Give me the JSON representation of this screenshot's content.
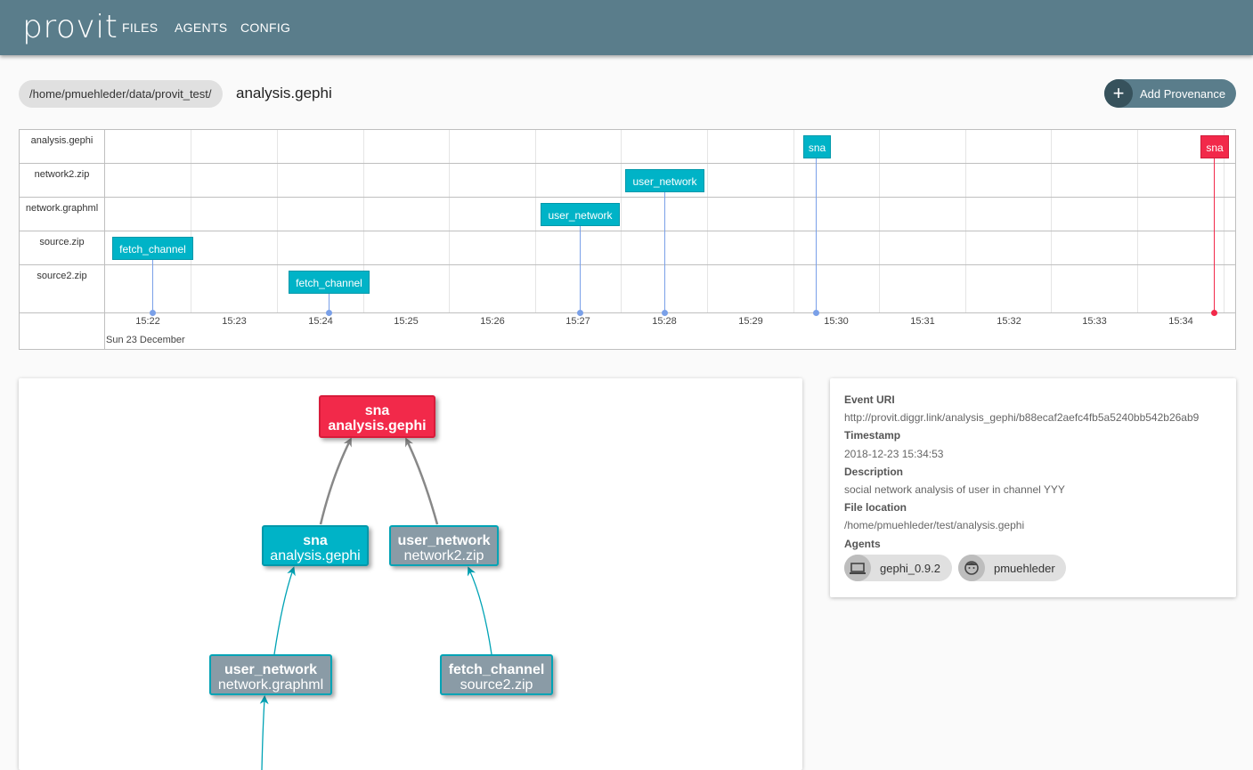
{
  "app": {
    "brand": "provit"
  },
  "nav": {
    "files": "FILES",
    "agents": "AGENTS",
    "config": "CONFIG"
  },
  "breadcrumb": {
    "path": "/home/pmuehleder/data/provit_test/",
    "file": "analysis.gephi"
  },
  "actions": {
    "add_provenance": "Add Provenance",
    "add_icon": "+"
  },
  "timeline": {
    "rows": [
      "analysis.gephi",
      "network2.zip",
      "network.graphml",
      "source.zip",
      "source2.zip"
    ],
    "ticks": [
      "15:22",
      "15:23",
      "15:24",
      "15:25",
      "15:26",
      "15:27",
      "15:28",
      "15:29",
      "15:30",
      "15:31",
      "15:32",
      "15:33",
      "15:34"
    ],
    "date": "Sun 23 December",
    "events": [
      {
        "label": "sna",
        "row": "analysis.gephi",
        "time": "15:29:45",
        "color": "#00b3c7"
      },
      {
        "label": "sna",
        "row": "analysis.gephi",
        "time": "15:34:53",
        "color": "#f2294a",
        "selected": true
      },
      {
        "label": "user_network",
        "row": "network2.zip",
        "time": "15:28:00",
        "color": "#00b3c7"
      },
      {
        "label": "user_network",
        "row": "network.graphml",
        "time": "15:27:00",
        "color": "#00b3c7"
      },
      {
        "label": "fetch_channel",
        "row": "source.zip",
        "time": "15:22:00",
        "color": "#00b3c7"
      },
      {
        "label": "fetch_channel",
        "row": "source2.zip",
        "time": "15:24:00",
        "color": "#00b3c7"
      }
    ]
  },
  "graph": {
    "nodes": {
      "sna_selected": {
        "activity": "sna",
        "file": "analysis.gephi",
        "color": "#f2294a"
      },
      "sna": {
        "activity": "sna",
        "file": "analysis.gephi",
        "color": "#00b3c7"
      },
      "user_network_2": {
        "activity": "user_network",
        "file": "network2.zip",
        "color": "#8a9ba6"
      },
      "user_network_graphml": {
        "activity": "user_network",
        "file": "network.graphml",
        "color": "#8a9ba6"
      },
      "fetch_channel_2": {
        "activity": "fetch_channel",
        "file": "source2.zip",
        "color": "#8a9ba6"
      }
    }
  },
  "details": {
    "event_uri_label": "Event URI",
    "event_uri": "http://provit.diggr.link/analysis_gephi/b88ecaf2aefc4fb5a5240bb542b26ab9",
    "timestamp_label": "Timestamp",
    "timestamp": "2018-12-23 15:34:53",
    "description_label": "Description",
    "description": "social network analysis of user in channel YYY",
    "location_label": "File location",
    "location": "/home/pmuehleder/test/analysis.gephi",
    "agents_label": "Agents",
    "agents": [
      {
        "name": "gephi_0.9.2",
        "icon": "laptop-icon"
      },
      {
        "name": "pmuehleder",
        "icon": "person-icon"
      }
    ]
  }
}
